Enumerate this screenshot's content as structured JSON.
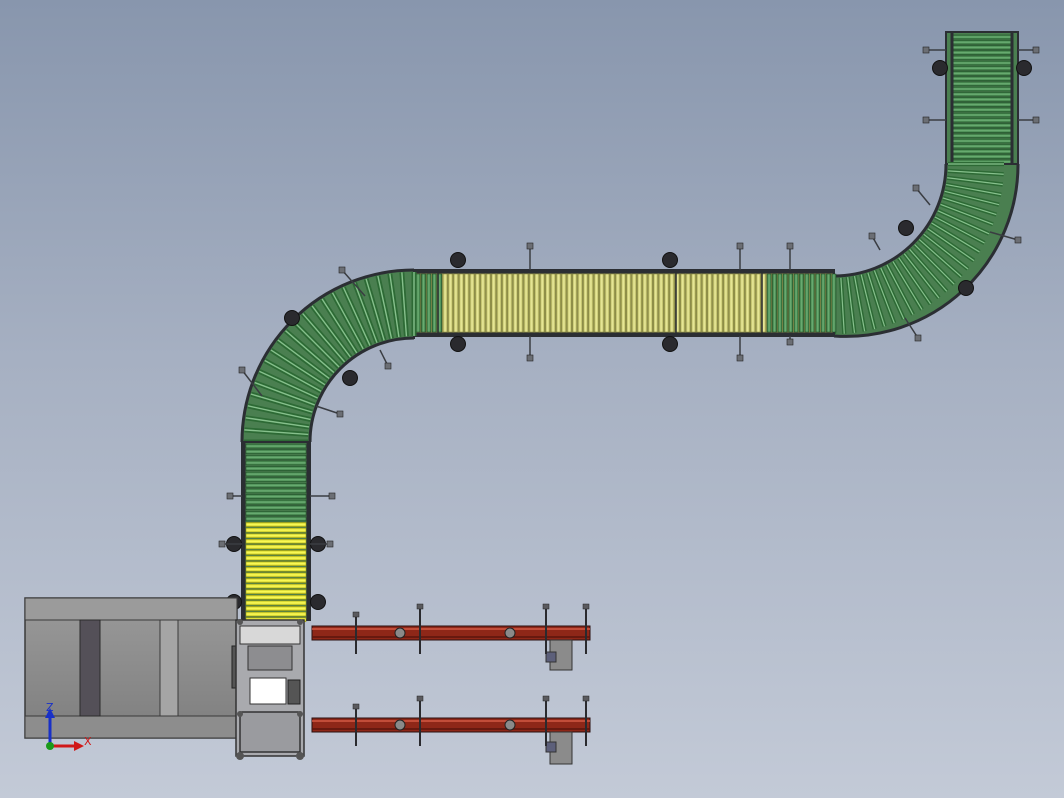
{
  "view": {
    "background_top": "#8896ad",
    "background_bottom": "#c3cad7"
  },
  "colors": {
    "roller_green": "#3f8a4a",
    "roller_green_light": "#86c08c",
    "roller_yellow": "#d8d873",
    "roller_yellow_bright": "#f2f230",
    "frame_dark": "#3a3d42",
    "chain_red": "#a12a1c",
    "machine_gray": "#8c8c8c",
    "axis_x": "#d01818",
    "axis_y": "#1a9a1a",
    "axis_z": "#1830c8"
  },
  "triad": {
    "z_label": "Z",
    "x_label": "X"
  },
  "components": [
    {
      "id": "top-right-straight-conveyor",
      "color": "green"
    },
    {
      "id": "right-curve-conveyor",
      "color": "green"
    },
    {
      "id": "middle-straight-conveyor",
      "color": "yellow"
    },
    {
      "id": "left-curve-conveyor",
      "color": "green"
    },
    {
      "id": "vertical-conveyor",
      "color": "green"
    },
    {
      "id": "accumulation-section",
      "color": "yellow"
    },
    {
      "id": "packing-machine",
      "color": "gray"
    },
    {
      "id": "chain-conveyor-upper",
      "color": "red"
    },
    {
      "id": "chain-conveyor-lower",
      "color": "red"
    }
  ]
}
